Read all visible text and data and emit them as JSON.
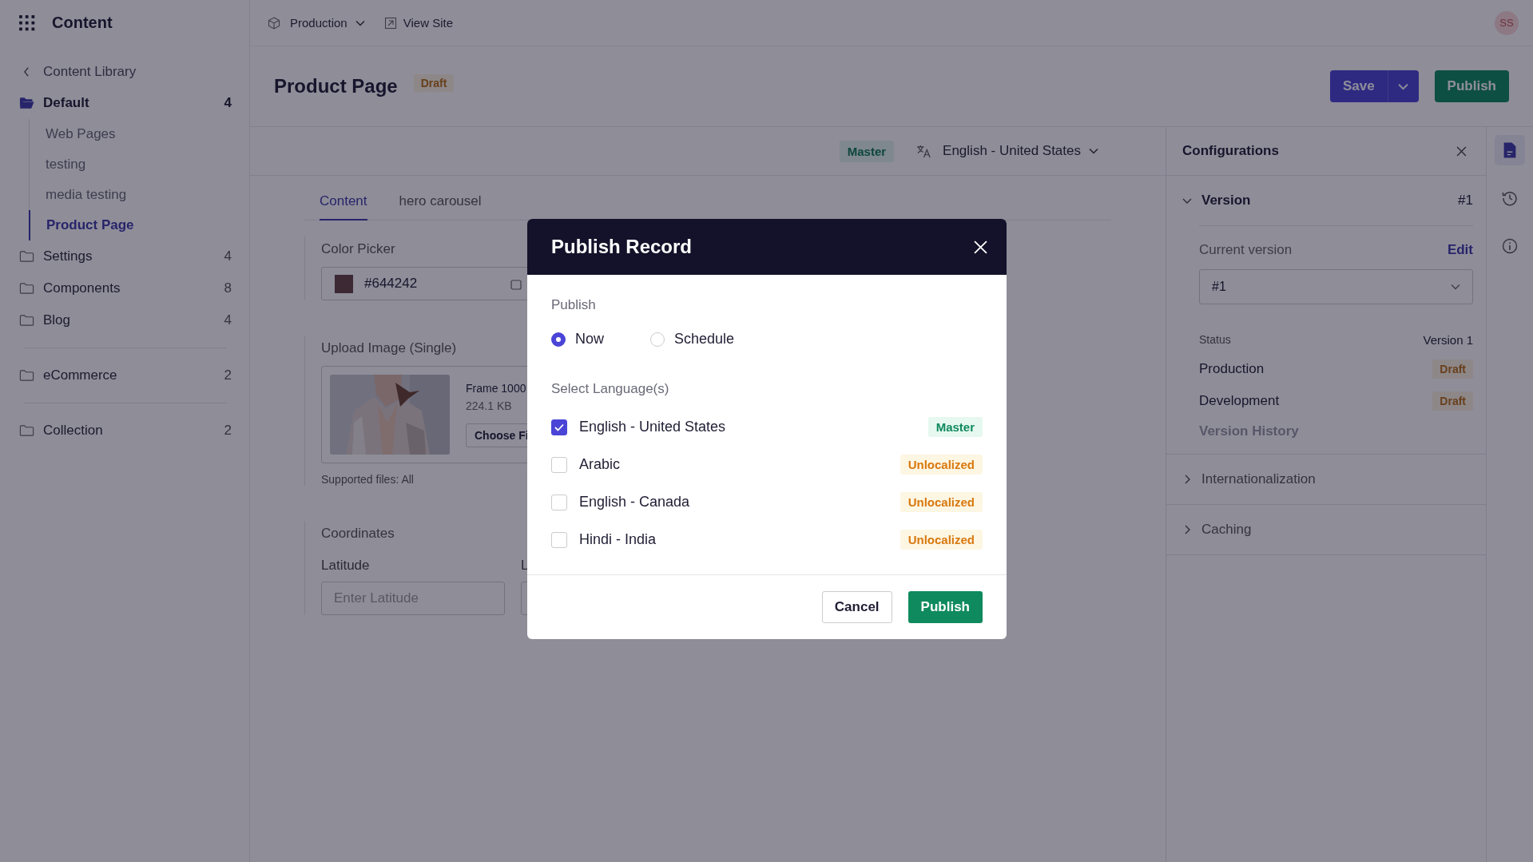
{
  "app": {
    "title": "Content"
  },
  "topbar": {
    "environment": "Production",
    "view_site": "View Site",
    "avatar": "SS"
  },
  "sidebar": {
    "back": "Content Library",
    "sections": [
      {
        "folders": [
          {
            "name": "Default",
            "count": "4",
            "expanded": true,
            "children": [
              {
                "name": "Web Pages",
                "selected": false
              },
              {
                "name": "testing",
                "selected": false
              },
              {
                "name": "media testing",
                "selected": false
              },
              {
                "name": "Product Page",
                "selected": true
              }
            ]
          },
          {
            "name": "Settings",
            "count": "4",
            "expanded": false
          },
          {
            "name": "Components",
            "count": "8",
            "expanded": false
          },
          {
            "name": "Blog",
            "count": "4",
            "expanded": false
          }
        ]
      },
      {
        "folders": [
          {
            "name": "eCommerce",
            "count": "2",
            "expanded": false
          }
        ]
      },
      {
        "folders": [
          {
            "name": "Collection",
            "count": "2",
            "expanded": false
          }
        ]
      }
    ]
  },
  "header": {
    "title": "Product Page",
    "status": "Draft",
    "save": "Save",
    "publish": "Publish"
  },
  "toolbar": {
    "master": "Master",
    "language": "English - United States"
  },
  "tabs": [
    {
      "label": "Content",
      "selected": true
    },
    {
      "label": "hero carousel",
      "selected": false
    }
  ],
  "form": {
    "color_picker": {
      "label": "Color Picker",
      "value": "#644242"
    },
    "upload": {
      "label": "Upload Image (Single)",
      "file_name": "Frame 1000",
      "file_size": "224.1 KB",
      "button": "Choose Fi",
      "hint": "Supported files: All"
    },
    "coordinates": {
      "label": "Coordinates",
      "latitude_label": "Latitude",
      "latitude_placeholder": "Enter Latitude",
      "longitude_label": "L"
    }
  },
  "configurations": {
    "title": "Configurations",
    "sections": [
      {
        "title": "Version",
        "value": "#1",
        "expanded": true
      },
      {
        "title": "Internationalization",
        "expanded": false
      },
      {
        "title": "Caching",
        "expanded": false
      }
    ],
    "version": {
      "current_label": "Current version",
      "edit": "Edit",
      "select_value": "#1",
      "status_label": "Status",
      "status_value": "Version 1",
      "environments": [
        {
          "name": "Production",
          "status": "Draft"
        },
        {
          "name": "Development",
          "status": "Draft"
        }
      ],
      "history": "Version History"
    }
  },
  "rail": [
    {
      "kind": "document",
      "selected": true
    },
    {
      "kind": "history",
      "selected": false
    },
    {
      "kind": "info",
      "selected": false
    }
  ],
  "modal": {
    "title": "Publish Record",
    "publish_label": "Publish",
    "options": [
      {
        "label": "Now",
        "selected": true
      },
      {
        "label": "Schedule",
        "selected": false
      }
    ],
    "languages_label": "Select Language(s)",
    "languages": [
      {
        "name": "English - United States",
        "checked": true,
        "tag": "Master",
        "kind": "master"
      },
      {
        "name": "Arabic",
        "checked": false,
        "tag": "Unlocalized",
        "kind": "unlocalized"
      },
      {
        "name": "English - Canada",
        "checked": false,
        "tag": "Unlocalized",
        "kind": "unlocalized"
      },
      {
        "name": "Hindi - India",
        "checked": false,
        "tag": "Unlocalized",
        "kind": "unlocalized"
      }
    ],
    "cancel": "Cancel",
    "confirm": "Publish"
  }
}
